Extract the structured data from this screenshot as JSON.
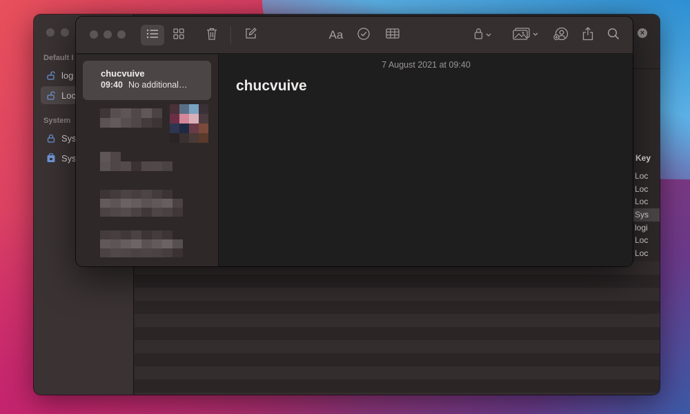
{
  "background_window": {
    "sidebar": {
      "sections": [
        {
          "label": "Default I",
          "items": [
            "log",
            "Loc"
          ]
        },
        {
          "label": "System",
          "items": [
            "Sys",
            "Sys"
          ]
        }
      ]
    },
    "column_header": "Key",
    "rows": [
      "Loc",
      "Loc",
      "Loc",
      "Sys",
      "logi",
      "Loc",
      "Loc"
    ],
    "selected_row_index": 3
  },
  "notes_window": {
    "toolbar": {
      "icons": [
        "list-view-icon",
        "gallery-view-icon",
        "trash-icon",
        "compose-icon",
        "format-icon",
        "checklist-icon",
        "table-icon",
        "lock-icon",
        "media-icon",
        "collaborate-icon",
        "share-icon",
        "search-icon"
      ],
      "format_label": "Aa"
    },
    "selected_note": {
      "title": "chucvuive",
      "time": "09:40",
      "preview": "No additional…"
    },
    "editor": {
      "date": "7 August 2021 at 09:40",
      "title": "chucvuive"
    }
  }
}
